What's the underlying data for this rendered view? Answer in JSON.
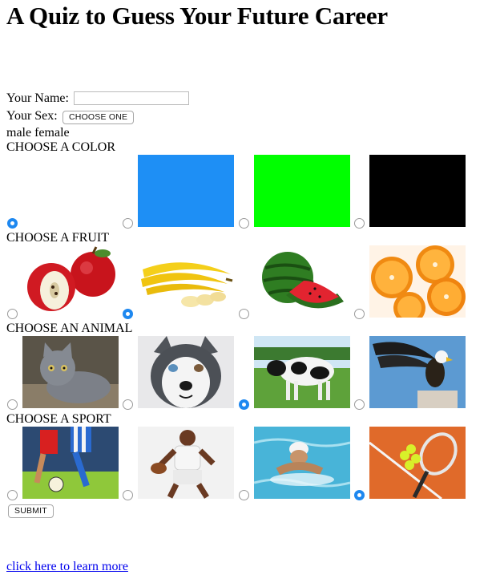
{
  "page": {
    "title": "A Quiz to Guess Your Future Career"
  },
  "form": {
    "name_label": "Your Name:",
    "name_value": "",
    "sex_label": "Your Sex:",
    "sex_button": "CHOOSE ONE",
    "sex_options_text": "male female",
    "submit_label": "SUBMIT"
  },
  "questions": {
    "color": {
      "heading": "CHOOSE A COLOR",
      "options": [
        {
          "name": "white",
          "swatch": "#ffffff",
          "checked": true
        },
        {
          "name": "blue",
          "swatch": "#1e8ff5",
          "checked": false
        },
        {
          "name": "green",
          "swatch": "#00ff00",
          "checked": false
        },
        {
          "name": "black",
          "swatch": "#000000",
          "checked": false
        }
      ]
    },
    "fruit": {
      "heading": "CHOOSE A FRUIT",
      "options": [
        {
          "icon": "apple-image",
          "checked": false
        },
        {
          "icon": "banana-image",
          "checked": true
        },
        {
          "icon": "watermelon-image",
          "checked": false
        },
        {
          "icon": "orange-image",
          "checked": false
        }
      ]
    },
    "animal": {
      "heading": "CHOOSE AN ANIMAL",
      "options": [
        {
          "icon": "kitten-image",
          "checked": false
        },
        {
          "icon": "husky-image",
          "checked": false
        },
        {
          "icon": "cow-image",
          "checked": true
        },
        {
          "icon": "eagle-image",
          "checked": false
        }
      ]
    },
    "sport": {
      "heading": "CHOOSE A SPORT",
      "options": [
        {
          "icon": "soccer-image",
          "checked": false
        },
        {
          "icon": "basketball-image",
          "checked": false
        },
        {
          "icon": "swimming-image",
          "checked": false
        },
        {
          "icon": "tennis-image",
          "checked": true
        }
      ]
    }
  },
  "footer": {
    "link_text": "click here to learn more"
  },
  "colors": {
    "accent": "#1e88f0",
    "link": "#0000ee"
  }
}
